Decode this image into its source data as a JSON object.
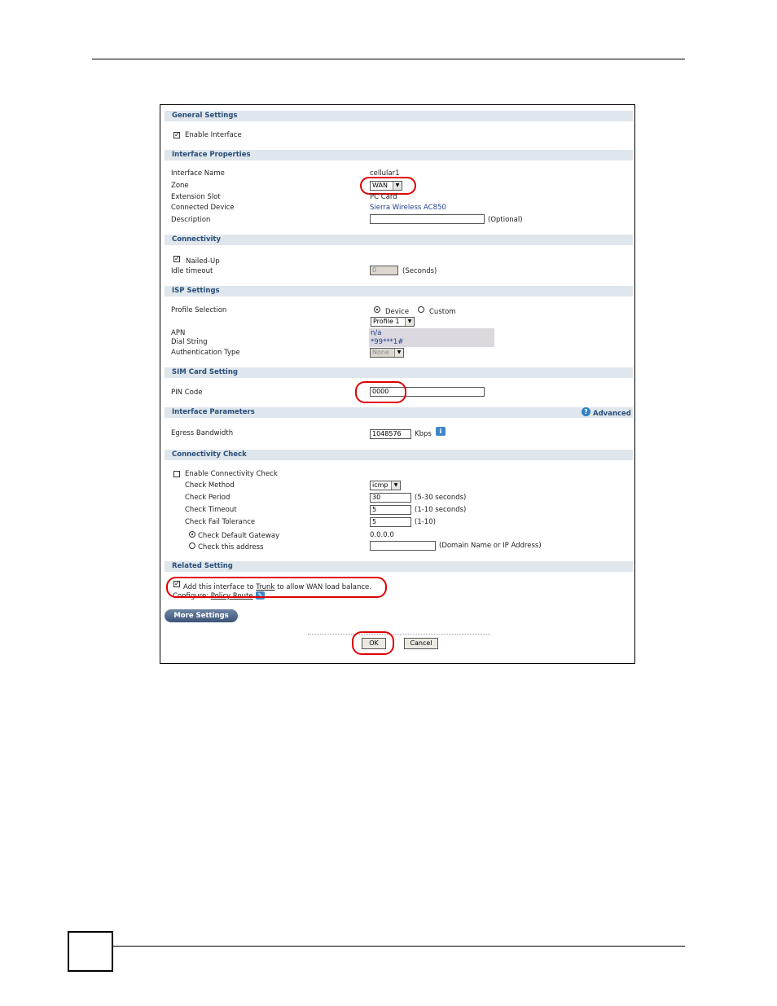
{
  "sections": {
    "general": "General Settings",
    "interface_properties": "Interface Properties",
    "connectivity": "Connectivity",
    "isp": "ISP Settings",
    "sim": "SIM Card Setting",
    "params": "Interface Parameters",
    "conn_check": "Connectivity Check",
    "related": "Related Setting"
  },
  "general": {
    "enable_interface": "Enable Interface",
    "enable_checked": true
  },
  "props": {
    "name_label": "Interface Name",
    "name_value": "cellular1",
    "zone_label": "Zone",
    "zone_value": "WAN",
    "slot_label": "Extension Slot",
    "slot_value": "PC Card",
    "device_label": "Connected Device",
    "device_value": "Sierra Wireless AC850",
    "desc_label": "Description",
    "desc_value": "",
    "desc_hint": "(Optional)"
  },
  "connectivity": {
    "nailed_up": "Nailed-Up",
    "nailed_checked": true,
    "idle_label": "Idle timeout",
    "idle_value": "0",
    "idle_unit": "(Seconds)"
  },
  "isp": {
    "profile_label": "Profile Selection",
    "device_option": "Device",
    "custom_option": "Custom",
    "selected": "Device",
    "profile_value": "Profile 1",
    "apn_label": "APN",
    "apn_value": "n/a",
    "dial_label": "Dial String",
    "dial_value": "*99***1#",
    "auth_label": "Authentication Type",
    "auth_value": "None"
  },
  "sim": {
    "pin_label": "PIN Code",
    "pin_value": "0000"
  },
  "params": {
    "advanced_label": "Advanced",
    "egress_label": "Egress Bandwidth",
    "egress_value": "1048576",
    "egress_unit": "Kbps"
  },
  "conn_check": {
    "enable_label": "Enable Connectivity Check",
    "enable_checked": false,
    "method_label": "Check Method",
    "method_value": "icmp",
    "period_label": "Check Period",
    "period_value": "30",
    "period_hint": "(5-30 seconds)",
    "timeout_label": "Check Timeout",
    "timeout_value": "5",
    "timeout_hint": "(1-10 seconds)",
    "fail_label": "Check Fail Tolerance",
    "fail_value": "5",
    "fail_hint": "(1-10)",
    "default_gw_label": "Check Default Gateway",
    "default_gw_value": "0.0.0.0",
    "this_addr_label": "Check this address",
    "this_addr_value": "",
    "this_addr_hint": "(Domain Name or IP Address)"
  },
  "related": {
    "trunk_pre": "Add this interface to",
    "trunk_link": "Trunk",
    "trunk_post": "to allow WAN load balance.",
    "trunk_checked": true,
    "configure_label": "Configure:",
    "policy_route_link": "Policy Route"
  },
  "buttons": {
    "more": "More Settings",
    "ok": "OK",
    "cancel": "Cancel"
  },
  "colors": {
    "section_bg": "#dfe6ec",
    "section_text": "#2a4f7a",
    "highlight": "#e00000"
  }
}
